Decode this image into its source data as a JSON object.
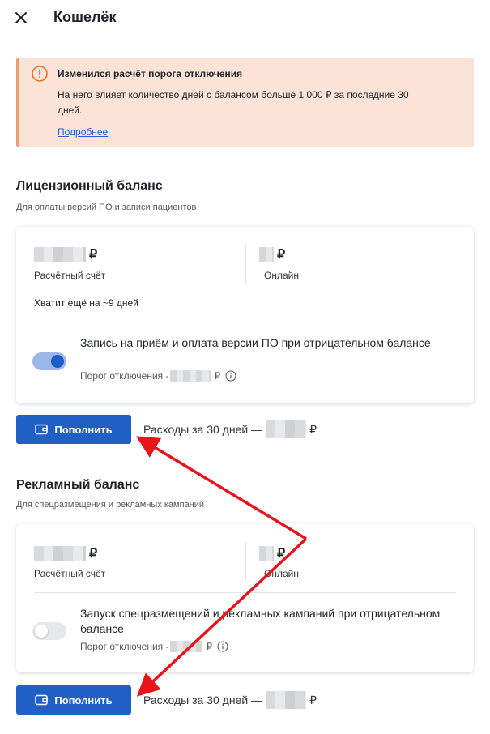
{
  "header": {
    "title": "Кошелёк"
  },
  "alert": {
    "title": "Изменился расчёт порога отключения",
    "text": "На него влияет количество дней с балансом больше 1 000 ₽ за последние 30 дней.",
    "link": "Подробнее"
  },
  "license": {
    "title": "Лицензионный баланс",
    "subtitle": "Для оплаты версий ПО и записи пациентов",
    "currency": "₽",
    "account_label": "Расчётный счёт",
    "online_label": "Онлайн",
    "remaining": "Хватит ещё на ~9 дней",
    "option_text": "Запись на приём и оплата версии ПО при отрицательном балансе",
    "toggle_on": true,
    "threshold_label": "Порог отключения -",
    "topup_label": "Пополнить",
    "expense_label": "Расходы за 30 дней —"
  },
  "ads": {
    "title": "Рекламный баланс",
    "subtitle": "Для спецразмещения и рекламных кампаний",
    "currency": "₽",
    "account_label": "Расчётный счёт",
    "online_label": "Онлайн",
    "option_text": "Запуск спецразмещений и рекламных кампаний при отрицательном балансе",
    "toggle_on": false,
    "threshold_label": "Порог отключения -",
    "topup_label": "Пополнить",
    "expense_label": "Расходы за 30 дней —"
  },
  "colors": {
    "accent": "#1f5fc6",
    "alert_bg": "#fbe3d8",
    "alert_border": "#ee9a73",
    "annotation": "#e8141c"
  }
}
